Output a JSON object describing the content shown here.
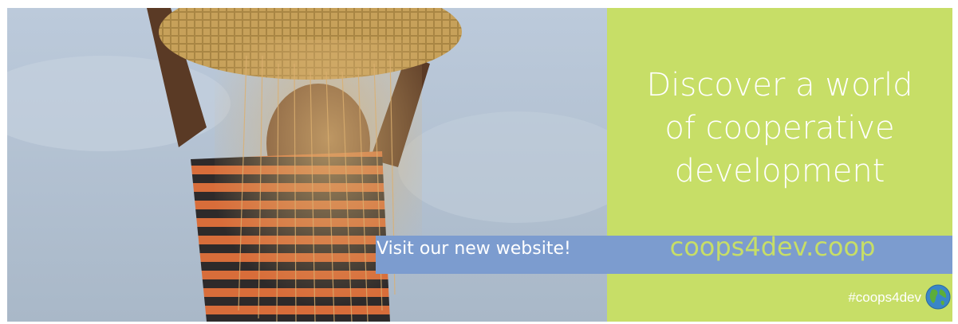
{
  "headline": {
    "line1": "Discover a world",
    "line2": "of cooperative",
    "line3": "development"
  },
  "cta": {
    "label": "Visit our new website!"
  },
  "url": {
    "text": "coops4dev.coop"
  },
  "hashtag": {
    "text": "#coops4dev"
  },
  "icons": {
    "globe": "globe-icon"
  },
  "colors": {
    "green_panel": "#c7de67",
    "blue_stripe": "#7c9ccf",
    "text": "#ffffff"
  }
}
